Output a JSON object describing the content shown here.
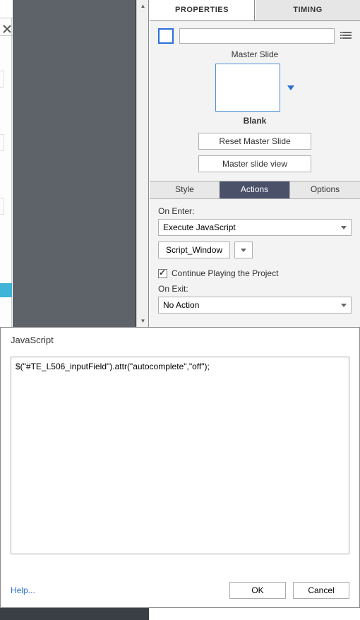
{
  "tabs": {
    "properties": "PROPERTIES",
    "timing": "TIMING"
  },
  "slide_name": "",
  "master": {
    "heading": "Master Slide",
    "name": "Blank",
    "reset_btn": "Reset Master Slide",
    "view_btn": "Master slide view"
  },
  "sub_tabs": {
    "style": "Style",
    "actions": "Actions",
    "options": "Options"
  },
  "on_enter": {
    "label": "On Enter:",
    "action": "Execute JavaScript",
    "script_btn": "Script_Window",
    "continue_label": "Continue Playing the Project"
  },
  "on_exit": {
    "label": "On Exit:",
    "action": "No Action"
  },
  "dialog": {
    "title": "JavaScript",
    "code": "$(\"#TE_L506_inputField\").attr(\"autocomplete\",\"off\");",
    "help": "Help...",
    "ok": "OK",
    "cancel": "Cancel"
  }
}
